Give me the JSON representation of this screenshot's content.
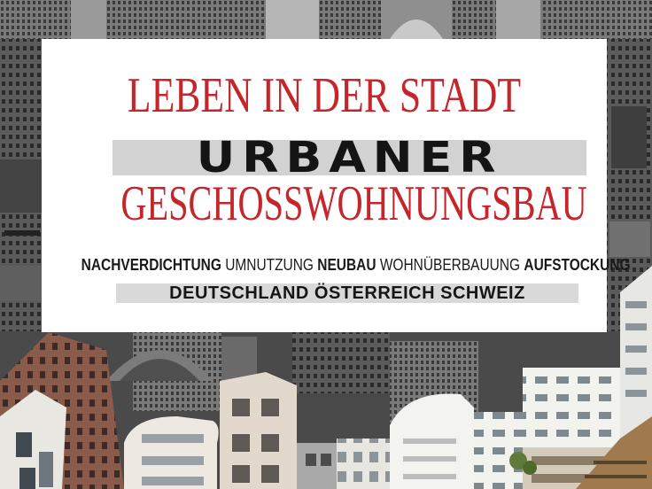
{
  "cover": {
    "title_line1": "LEBEN IN DER STADT",
    "title_line2": "URBANER",
    "title_line3": "GESCHOSSWOHNUNGSBAU",
    "topics": [
      {
        "text": "NACHVERDICHTUNG",
        "weight": "bold"
      },
      {
        "text": "UMNUTZUNG",
        "weight": "light"
      },
      {
        "text": "NEUBAU",
        "weight": "bold"
      },
      {
        "text": "WOHNÜBERBAUUNG",
        "weight": "light"
      },
      {
        "text": "AUFSTOCKUNG",
        "weight": "bold"
      }
    ],
    "countries": "DEUTSCHLAND ÖSTERREICH SCHWEIZ"
  },
  "colors": {
    "title_red": "#c4262b",
    "text_dark": "#141414",
    "highlight_gray": "#d2d2d2",
    "panel_white": "#ffffff"
  }
}
